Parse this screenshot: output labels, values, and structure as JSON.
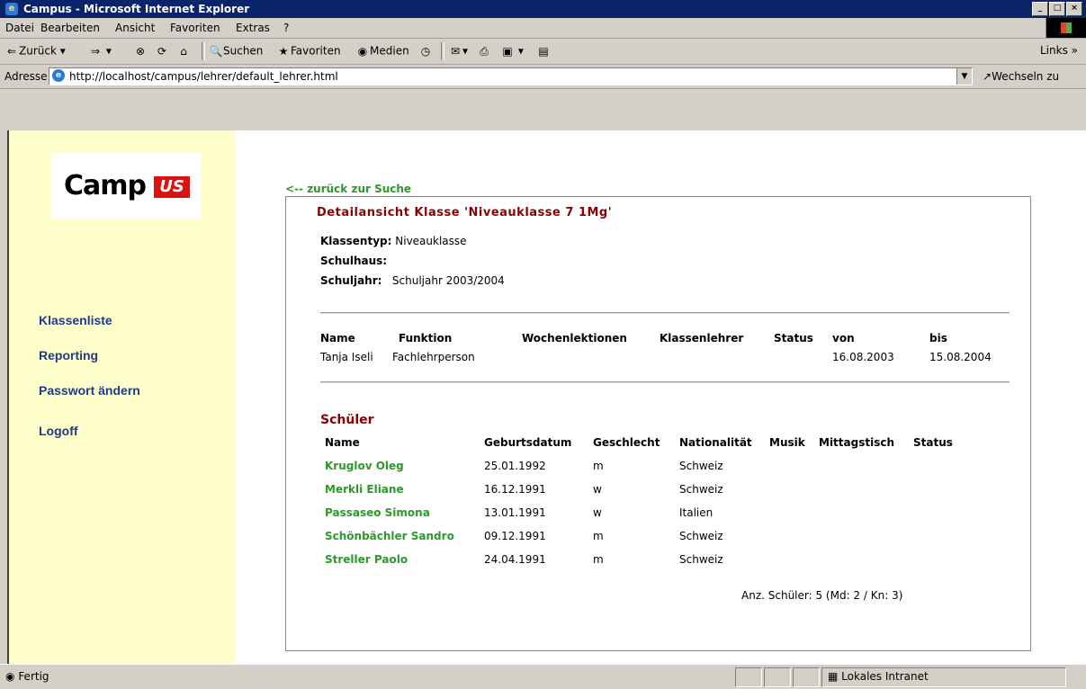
{
  "window": {
    "title": "Campus - Microsoft Internet Explorer"
  },
  "menu": [
    "Datei",
    "Bearbeiten",
    "Ansicht",
    "Favoriten",
    "Extras",
    "?"
  ],
  "toolbar": {
    "back": "Zurück",
    "search": "Suchen",
    "favorites": "Favoriten",
    "media": "Medien",
    "links": "Links »"
  },
  "address": {
    "label": "Adresse",
    "url": "http://localhost/campus/lehrer/default_lehrer.html",
    "go": "Wechseln zu"
  },
  "sidebar": {
    "logo_text": "Camp",
    "logo_us": "US",
    "items": [
      "Klassenliste",
      "Reporting",
      "Passwort ändern",
      "Logoff"
    ]
  },
  "content": {
    "back_link": "<-- zurück zur Suche",
    "title": "Detailansicht Klasse 'Niveauklasse 7 1Mg'",
    "klassentyp_label": "Klassentyp:",
    "klassentyp_value": "Niveauklasse",
    "schulhaus_label": "Schulhaus:",
    "schuljahr_label": "Schuljahr:",
    "schuljahr_value": "Schuljahr 2003/2004",
    "teacher_headers": [
      "Name",
      "Funktion",
      "Wochenlektionen",
      "Klassenlehrer",
      "Status",
      "von",
      "bis"
    ],
    "teacher_row": {
      "name": "Tanja Iseli",
      "function": "Fachlehrperson",
      "from": "16.08.2003",
      "to": "15.08.2004"
    },
    "students_title": "Schüler",
    "student_headers": [
      "Name",
      "Geburtsdatum",
      "Geschlecht",
      "Nationalität",
      "Musik",
      "Mittagstisch",
      "Status"
    ],
    "students": [
      {
        "name": "Kruglov Oleg",
        "birth": "25.01.1992",
        "gender": "m",
        "nationality": "Schweiz"
      },
      {
        "name": "Merkli Eliane",
        "birth": "16.12.1991",
        "gender": "w",
        "nationality": "Schweiz"
      },
      {
        "name": "Passaseo Simona",
        "birth": "13.01.1991",
        "gender": "w",
        "nationality": "Italien"
      },
      {
        "name": "Schönbächler Sandro",
        "birth": "09.12.1991",
        "gender": "m",
        "nationality": "Schweiz"
      },
      {
        "name": "Streller Paolo",
        "birth": "24.04.1991",
        "gender": "m",
        "nationality": "Schweiz"
      }
    ],
    "summary": "Anz. Schüler: 5 (Md: 2 / Kn: 3)"
  },
  "status": {
    "left": "Fertig",
    "zone": "Lokales Intranet"
  }
}
